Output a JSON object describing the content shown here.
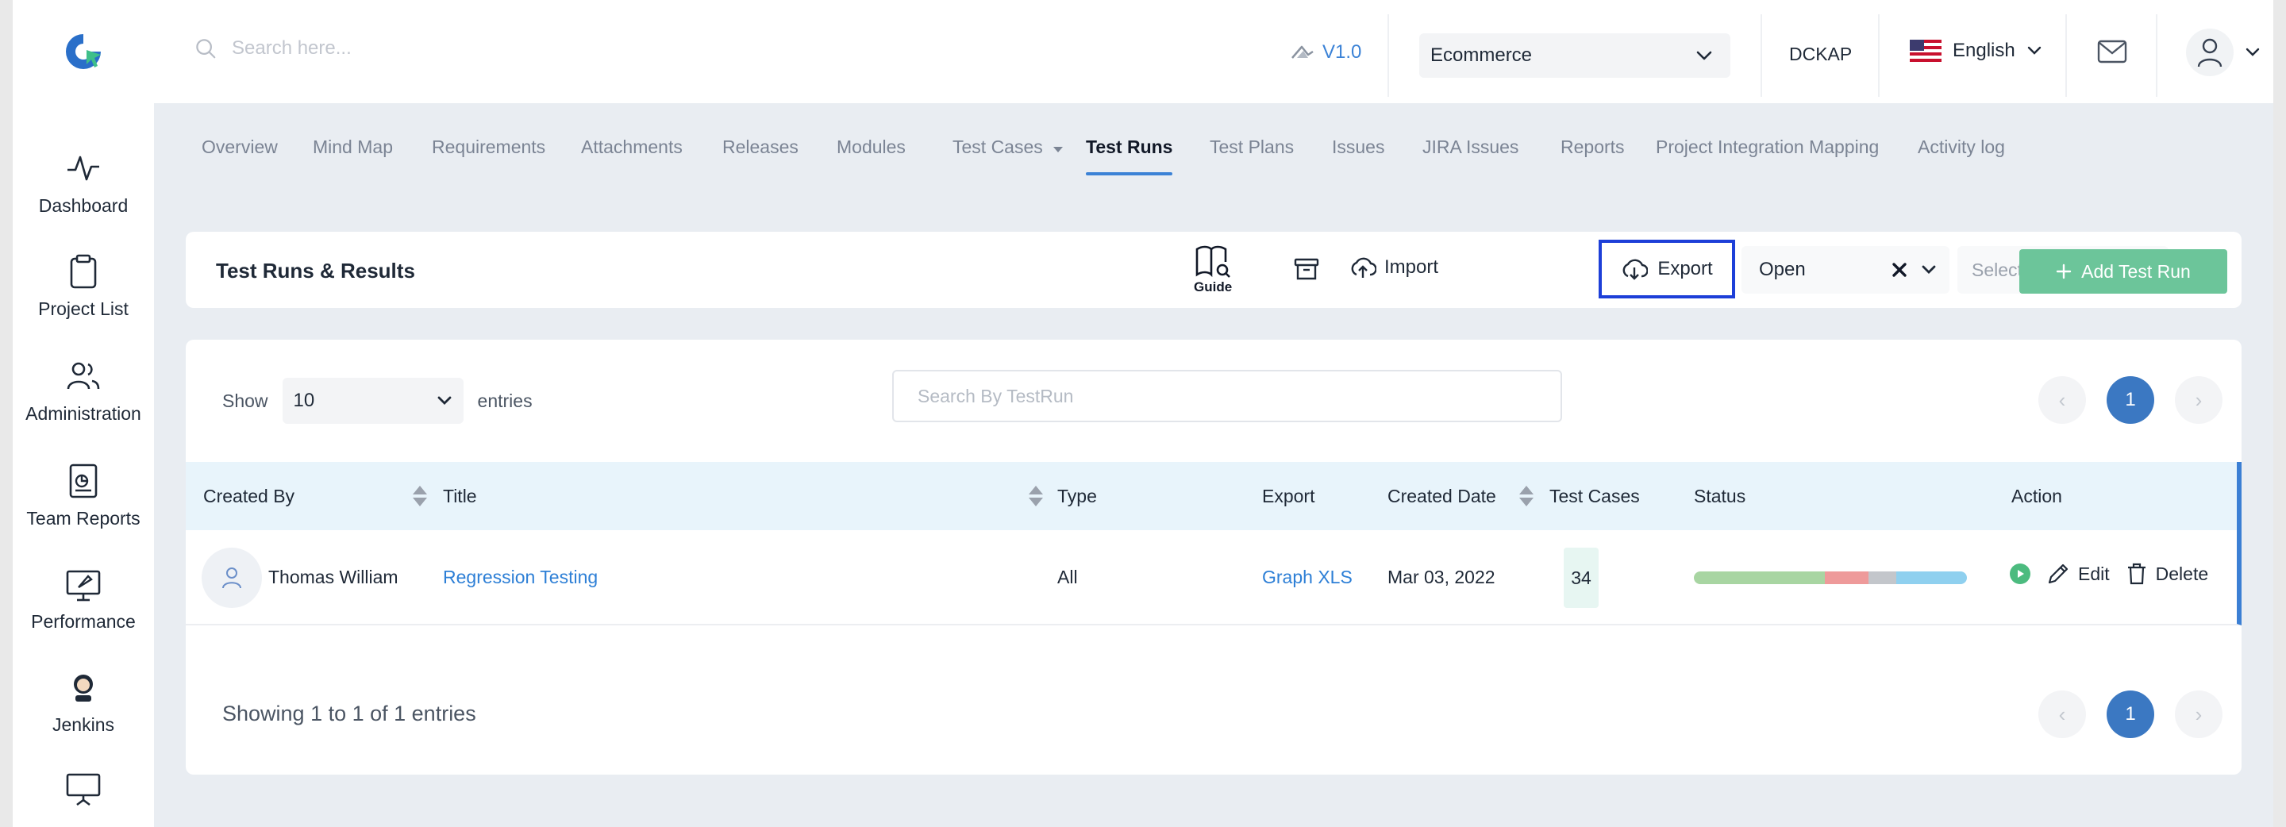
{
  "header": {
    "search_placeholder": "Search here...",
    "version": "V1.0",
    "project": "Ecommerce",
    "org": "DCKAP",
    "language": "English"
  },
  "sidebar": {
    "items": [
      {
        "label": "Dashboard",
        "icon": "activity-icon"
      },
      {
        "label": "Project List",
        "icon": "clipboard-icon"
      },
      {
        "label": "Administration",
        "icon": "users-icon"
      },
      {
        "label": "Team Reports",
        "icon": "report-icon"
      },
      {
        "label": "Performance",
        "icon": "rocket-icon"
      },
      {
        "label": "Jenkins",
        "icon": "jenkins-icon"
      },
      {
        "label": "",
        "icon": "presentation-icon"
      }
    ]
  },
  "tabs": [
    {
      "label": "Overview"
    },
    {
      "label": "Mind Map"
    },
    {
      "label": "Requirements"
    },
    {
      "label": "Attachments"
    },
    {
      "label": "Releases"
    },
    {
      "label": "Modules"
    },
    {
      "label": "Test Cases"
    },
    {
      "label": "Test Runs"
    },
    {
      "label": "Test Plans"
    },
    {
      "label": "Issues"
    },
    {
      "label": "JIRA Issues"
    },
    {
      "label": "Reports"
    },
    {
      "label": "Project Integration Mapping"
    },
    {
      "label": "Activity log"
    }
  ],
  "toolbar": {
    "title": "Test Runs & Results",
    "guide_label": "Guide",
    "import_label": "Import",
    "export_label": "Export",
    "status_value": "Open",
    "release_placeholder": "Select a Release",
    "add_label": "Add Test Run"
  },
  "table": {
    "show_label": "Show",
    "page_size": "10",
    "entries_label": "entries",
    "search_placeholder": "Search By TestRun",
    "page": "1",
    "prev": "‹",
    "next": "›",
    "columns": [
      "Created By",
      "Title",
      "Type",
      "Export",
      "Created Date",
      "Test Cases",
      "Status",
      "Action"
    ],
    "rows": [
      {
        "created_by": "Thomas William",
        "title": "Regression Testing",
        "type": "All",
        "export": "Graph XLS",
        "created_date": "Mar 03, 2022",
        "test_cases": "34",
        "status_segments": [
          {
            "color": "#a8d5a2",
            "fraction": 0.48
          },
          {
            "color": "#ee9a9a",
            "fraction": 0.16
          },
          {
            "color": "#c3c6cb",
            "fraction": 0.1
          },
          {
            "color": "#8fd0ef",
            "fraction": 0.26
          }
        ],
        "edit_label": "Edit",
        "delete_label": "Delete"
      }
    ],
    "footer": "Showing 1 to 1 of 1 entries"
  },
  "colors": {
    "accent": "#3b82d6",
    "add_button": "#6cc59a",
    "export_highlight": "#1d3fd8"
  }
}
